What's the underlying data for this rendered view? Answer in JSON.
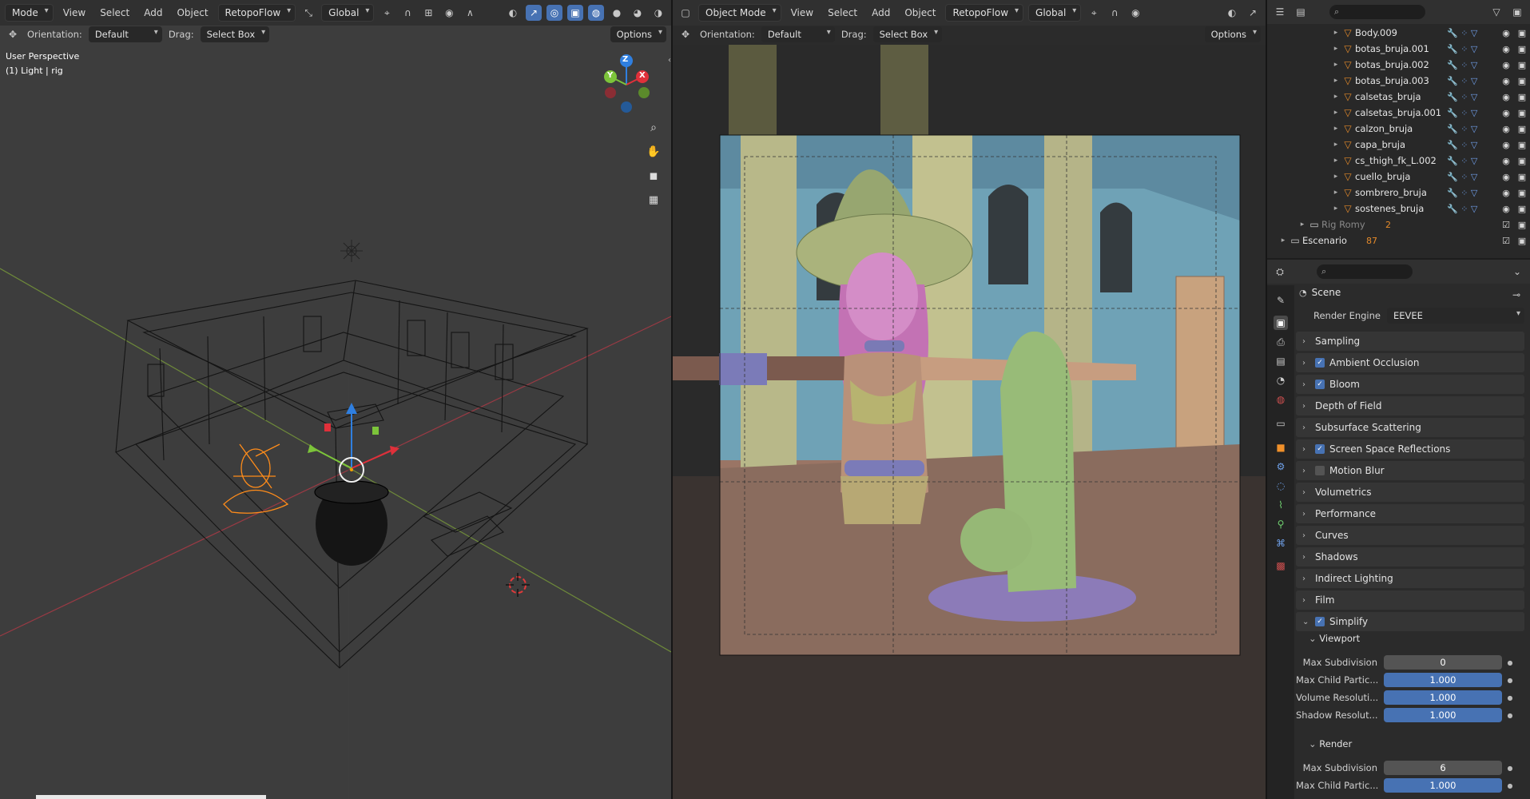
{
  "left_viewport": {
    "header": {
      "mode": "Mode",
      "menus": [
        "View",
        "Select",
        "Add",
        "Object"
      ],
      "addon": "RetopoFlow",
      "transform": "Global"
    },
    "tool": {
      "orientation_label": "Orientation:",
      "orientation_value": "Default",
      "drag_label": "Drag:",
      "drag_value": "Select Box",
      "options": "Options"
    },
    "overlay": {
      "view_name": "User Perspective",
      "active": "(1) Light | rig"
    },
    "gizmo": {
      "z": "Z",
      "y": "Y",
      "x": "X"
    }
  },
  "right_viewport": {
    "header": {
      "mode": "Object Mode",
      "menus": [
        "View",
        "Select",
        "Add",
        "Object"
      ],
      "addon": "RetopoFlow",
      "transform": "Global"
    },
    "tool": {
      "orientation_label": "Orientation:",
      "orientation_value": "Default",
      "drag_label": "Drag:",
      "drag_value": "Select Box",
      "options": "Options"
    }
  },
  "outliner": {
    "items": [
      {
        "name": "Body.009"
      },
      {
        "name": "botas_bruja.001"
      },
      {
        "name": "botas_bruja.002"
      },
      {
        "name": "botas_bruja.003"
      },
      {
        "name": "calsetas_bruja"
      },
      {
        "name": "calsetas_bruja.001"
      },
      {
        "name": "calzon_bruja"
      },
      {
        "name": "capa_bruja"
      },
      {
        "name": "cs_thigh_fk_L.002"
      },
      {
        "name": "cuello_bruja"
      },
      {
        "name": "sombrero_bruja"
      },
      {
        "name": "sostenes_bruja"
      }
    ],
    "collections": [
      {
        "name": "Rig Romy",
        "count": "2"
      },
      {
        "name": "Escenario",
        "count": "87"
      }
    ]
  },
  "properties": {
    "context": "Scene",
    "render_engine_label": "Render Engine",
    "render_engine": "EEVEE",
    "panels": [
      {
        "label": "Sampling",
        "checkbox": null
      },
      {
        "label": "Ambient Occlusion",
        "checkbox": true
      },
      {
        "label": "Bloom",
        "checkbox": true
      },
      {
        "label": "Depth of Field",
        "checkbox": null
      },
      {
        "label": "Subsurface Scattering",
        "checkbox": null
      },
      {
        "label": "Screen Space Reflections",
        "checkbox": true
      },
      {
        "label": "Motion Blur",
        "checkbox": false
      },
      {
        "label": "Volumetrics",
        "checkbox": null
      },
      {
        "label": "Performance",
        "checkbox": null
      },
      {
        "label": "Curves",
        "checkbox": null
      },
      {
        "label": "Shadows",
        "checkbox": null
      },
      {
        "label": "Indirect Lighting",
        "checkbox": null
      },
      {
        "label": "Film",
        "checkbox": null
      }
    ],
    "simplify": {
      "label": "Simplify",
      "viewport_label": "Viewport",
      "viewport": [
        {
          "label": "Max Subdivision",
          "value": "0"
        },
        {
          "label": "Max Child Partic...",
          "value": "1.000"
        },
        {
          "label": "Volume Resoluti...",
          "value": "1.000"
        },
        {
          "label": "Shadow Resolut...",
          "value": "1.000"
        }
      ],
      "render_label": "Render",
      "render": [
        {
          "label": "Max Subdivision",
          "value": "6"
        },
        {
          "label": "Max Child Partic...",
          "value": "1.000"
        }
      ]
    }
  }
}
